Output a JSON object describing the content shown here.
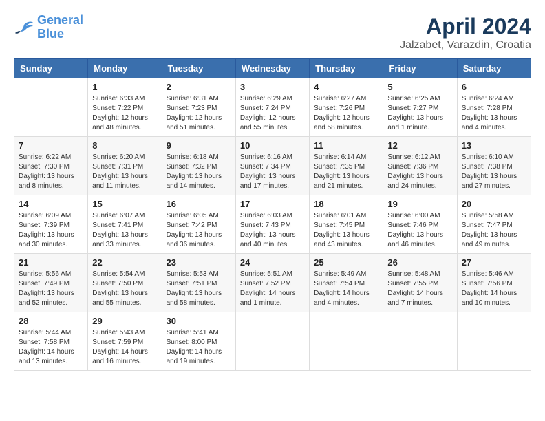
{
  "header": {
    "logo_line1": "General",
    "logo_line2": "Blue",
    "title": "April 2024",
    "subtitle": "Jalzabet, Varazdin, Croatia"
  },
  "calendar": {
    "days_of_week": [
      "Sunday",
      "Monday",
      "Tuesday",
      "Wednesday",
      "Thursday",
      "Friday",
      "Saturday"
    ],
    "weeks": [
      [
        {
          "day": "",
          "info": ""
        },
        {
          "day": "1",
          "info": "Sunrise: 6:33 AM\nSunset: 7:22 PM\nDaylight: 12 hours\nand 48 minutes."
        },
        {
          "day": "2",
          "info": "Sunrise: 6:31 AM\nSunset: 7:23 PM\nDaylight: 12 hours\nand 51 minutes."
        },
        {
          "day": "3",
          "info": "Sunrise: 6:29 AM\nSunset: 7:24 PM\nDaylight: 12 hours\nand 55 minutes."
        },
        {
          "day": "4",
          "info": "Sunrise: 6:27 AM\nSunset: 7:26 PM\nDaylight: 12 hours\nand 58 minutes."
        },
        {
          "day": "5",
          "info": "Sunrise: 6:25 AM\nSunset: 7:27 PM\nDaylight: 13 hours\nand 1 minute."
        },
        {
          "day": "6",
          "info": "Sunrise: 6:24 AM\nSunset: 7:28 PM\nDaylight: 13 hours\nand 4 minutes."
        }
      ],
      [
        {
          "day": "7",
          "info": "Sunrise: 6:22 AM\nSunset: 7:30 PM\nDaylight: 13 hours\nand 8 minutes."
        },
        {
          "day": "8",
          "info": "Sunrise: 6:20 AM\nSunset: 7:31 PM\nDaylight: 13 hours\nand 11 minutes."
        },
        {
          "day": "9",
          "info": "Sunrise: 6:18 AM\nSunset: 7:32 PM\nDaylight: 13 hours\nand 14 minutes."
        },
        {
          "day": "10",
          "info": "Sunrise: 6:16 AM\nSunset: 7:34 PM\nDaylight: 13 hours\nand 17 minutes."
        },
        {
          "day": "11",
          "info": "Sunrise: 6:14 AM\nSunset: 7:35 PM\nDaylight: 13 hours\nand 21 minutes."
        },
        {
          "day": "12",
          "info": "Sunrise: 6:12 AM\nSunset: 7:36 PM\nDaylight: 13 hours\nand 24 minutes."
        },
        {
          "day": "13",
          "info": "Sunrise: 6:10 AM\nSunset: 7:38 PM\nDaylight: 13 hours\nand 27 minutes."
        }
      ],
      [
        {
          "day": "14",
          "info": "Sunrise: 6:09 AM\nSunset: 7:39 PM\nDaylight: 13 hours\nand 30 minutes."
        },
        {
          "day": "15",
          "info": "Sunrise: 6:07 AM\nSunset: 7:41 PM\nDaylight: 13 hours\nand 33 minutes."
        },
        {
          "day": "16",
          "info": "Sunrise: 6:05 AM\nSunset: 7:42 PM\nDaylight: 13 hours\nand 36 minutes."
        },
        {
          "day": "17",
          "info": "Sunrise: 6:03 AM\nSunset: 7:43 PM\nDaylight: 13 hours\nand 40 minutes."
        },
        {
          "day": "18",
          "info": "Sunrise: 6:01 AM\nSunset: 7:45 PM\nDaylight: 13 hours\nand 43 minutes."
        },
        {
          "day": "19",
          "info": "Sunrise: 6:00 AM\nSunset: 7:46 PM\nDaylight: 13 hours\nand 46 minutes."
        },
        {
          "day": "20",
          "info": "Sunrise: 5:58 AM\nSunset: 7:47 PM\nDaylight: 13 hours\nand 49 minutes."
        }
      ],
      [
        {
          "day": "21",
          "info": "Sunrise: 5:56 AM\nSunset: 7:49 PM\nDaylight: 13 hours\nand 52 minutes."
        },
        {
          "day": "22",
          "info": "Sunrise: 5:54 AM\nSunset: 7:50 PM\nDaylight: 13 hours\nand 55 minutes."
        },
        {
          "day": "23",
          "info": "Sunrise: 5:53 AM\nSunset: 7:51 PM\nDaylight: 13 hours\nand 58 minutes."
        },
        {
          "day": "24",
          "info": "Sunrise: 5:51 AM\nSunset: 7:52 PM\nDaylight: 14 hours\nand 1 minute."
        },
        {
          "day": "25",
          "info": "Sunrise: 5:49 AM\nSunset: 7:54 PM\nDaylight: 14 hours\nand 4 minutes."
        },
        {
          "day": "26",
          "info": "Sunrise: 5:48 AM\nSunset: 7:55 PM\nDaylight: 14 hours\nand 7 minutes."
        },
        {
          "day": "27",
          "info": "Sunrise: 5:46 AM\nSunset: 7:56 PM\nDaylight: 14 hours\nand 10 minutes."
        }
      ],
      [
        {
          "day": "28",
          "info": "Sunrise: 5:44 AM\nSunset: 7:58 PM\nDaylight: 14 hours\nand 13 minutes."
        },
        {
          "day": "29",
          "info": "Sunrise: 5:43 AM\nSunset: 7:59 PM\nDaylight: 14 hours\nand 16 minutes."
        },
        {
          "day": "30",
          "info": "Sunrise: 5:41 AM\nSunset: 8:00 PM\nDaylight: 14 hours\nand 19 minutes."
        },
        {
          "day": "",
          "info": ""
        },
        {
          "day": "",
          "info": ""
        },
        {
          "day": "",
          "info": ""
        },
        {
          "day": "",
          "info": ""
        }
      ]
    ]
  }
}
